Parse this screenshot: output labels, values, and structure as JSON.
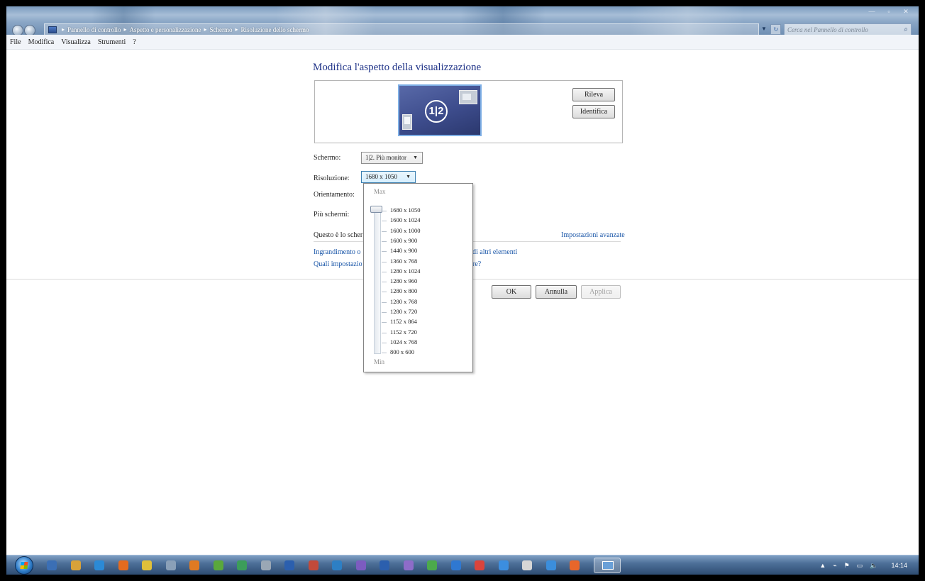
{
  "window": {
    "breadcrumb": [
      "Pannello di controllo",
      "Aspetto e personalizzazione",
      "Schermo",
      "Risoluzione dello schermo"
    ],
    "search_placeholder": "Cerca nel Pannello di controllo"
  },
  "menu": [
    "File",
    "Modifica",
    "Visualizza",
    "Strumenti",
    "?"
  ],
  "main": {
    "title": "Modifica l'aspetto della visualizzazione",
    "monitor_badge": "1|2",
    "detect_label": "Rileva",
    "identify_label": "Identifica",
    "display_label": "Schermo:",
    "display_value": "1|2. Più monitor",
    "resolution_label": "Risoluzione:",
    "resolution_value": "1680 x 1050",
    "orientation_label": "Orientamento:",
    "multiple_label": "Più schermi:",
    "main_display_text": "Questo è lo scher",
    "advanced_link": "Impostazioni avanzate",
    "link1_left": "Ingrandimento o",
    "link1_right": "di altri elementi",
    "link2_left": "Quali impostazio",
    "link2_right": "re?",
    "ok_label": "OK",
    "cancel_label": "Annulla",
    "apply_label": "Applica"
  },
  "resolution_dropdown": {
    "max_label": "Max",
    "min_label": "Min",
    "options": [
      "1680 x 1050",
      "1600 x 1024",
      "1600 x 1000",
      "1600 x 900",
      "1440 x 900",
      "1360 x 768",
      "1280 x 1024",
      "1280 x 960",
      "1280 x 800",
      "1280 x 768",
      "1280 x 720",
      "1152 x 864",
      "1152 x 720",
      "1024 x 768",
      "800 x 600"
    ],
    "selected_index": 0
  },
  "taskbar": {
    "clock": "14:14",
    "icons": [
      "explorer-icon",
      "media-icon",
      "ie-icon",
      "firefox-icon",
      "chrome-icon",
      "eye-icon",
      "vlc-icon",
      "leaf-icon",
      "globe-icon",
      "camera-icon",
      "word-icon",
      "maps-icon",
      "calendar-icon",
      "image-icon",
      "word2-icon",
      "paint-icon",
      "excel-icon",
      "blue-app-icon",
      "red-app-icon",
      "grid-icon",
      "gear-icon",
      "edit-icon",
      "folder-icon",
      "display-icon"
    ]
  }
}
